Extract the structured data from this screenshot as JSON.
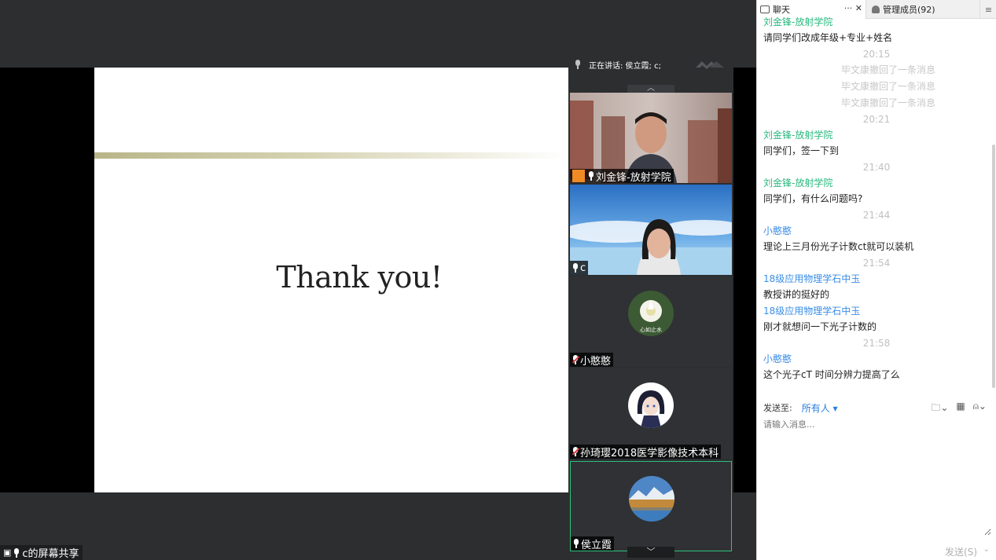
{
  "slide": {
    "text": "Thank you!"
  },
  "share_label": "c的屏幕共享",
  "speaking": {
    "label": "正在讲话: 侯立霞; c;"
  },
  "tiles": [
    {
      "name": "刘金锋-放射学院"
    },
    {
      "name": "c"
    },
    {
      "name": "小憨憨",
      "avatar_caption": "心如止水"
    },
    {
      "name": "孙琦璎2018医学影像技术本科"
    },
    {
      "name": "侯立霞"
    }
  ],
  "chat_tabs": {
    "chat": "聊天",
    "chat_actions": "··· ✕",
    "members": "管理成员(92)",
    "menu": "≡"
  },
  "messages": [
    {
      "kind": "sender",
      "text": "刘金锋-放射学院",
      "color": "green"
    },
    {
      "kind": "text",
      "text": "请同学们改成年级+专业+姓名"
    },
    {
      "kind": "time",
      "text": "20:15"
    },
    {
      "kind": "sys",
      "text": "毕文康撤回了一条消息"
    },
    {
      "kind": "sys",
      "text": "毕文康撤回了一条消息"
    },
    {
      "kind": "sys",
      "text": "毕文康撤回了一条消息"
    },
    {
      "kind": "time",
      "text": "20:21"
    },
    {
      "kind": "sender",
      "text": "刘金锋-放射学院",
      "color": "green"
    },
    {
      "kind": "text",
      "text": "同学们，签一下到"
    },
    {
      "kind": "time",
      "text": "21:40"
    },
    {
      "kind": "sender",
      "text": "刘金锋-放射学院",
      "color": "green"
    },
    {
      "kind": "text",
      "text": "同学们，有什么问题吗?"
    },
    {
      "kind": "time",
      "text": "21:44"
    },
    {
      "kind": "sender",
      "text": "小憨憨",
      "color": "blue"
    },
    {
      "kind": "text",
      "text": "理论上三月份光子计数ct就可以装机"
    },
    {
      "kind": "time",
      "text": "21:54"
    },
    {
      "kind": "sender",
      "text": "18级应用物理学石中玉",
      "color": "blue"
    },
    {
      "kind": "text",
      "text": "教授讲的挺好的"
    },
    {
      "kind": "sender",
      "text": "18级应用物理学石中玉",
      "color": "blue"
    },
    {
      "kind": "text",
      "text": "刚才就想问一下光子计数的"
    },
    {
      "kind": "time",
      "text": "21:58"
    },
    {
      "kind": "sender",
      "text": "小憨憨",
      "color": "blue"
    },
    {
      "kind": "text",
      "text": "这个光子cT 时间分辨力提高了么"
    }
  ],
  "composer": {
    "send_to_label": "发送至:",
    "send_to_value": "所有人 ▾",
    "placeholder": "请输入消息...",
    "send_button": "发送(S)",
    "send_arrow": "⌄"
  },
  "colors": {
    "sender_green": "#27b97f",
    "sender_blue": "#3a8ee6",
    "active_tile_border": "#2ec27e"
  }
}
